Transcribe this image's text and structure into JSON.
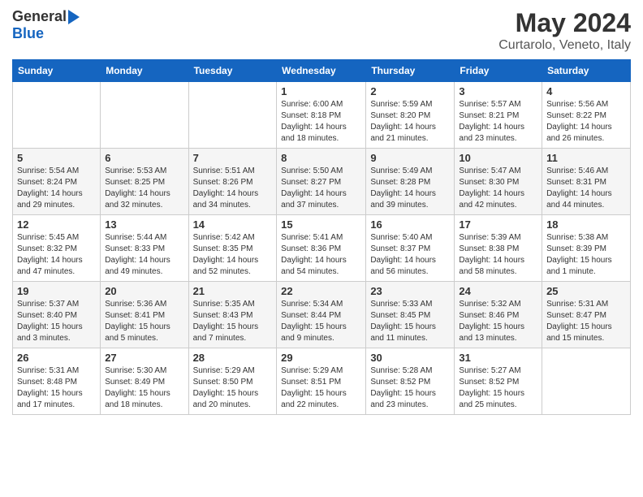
{
  "header": {
    "logo_general": "General",
    "logo_blue": "Blue",
    "month": "May 2024",
    "location": "Curtarolo, Veneto, Italy"
  },
  "columns": [
    "Sunday",
    "Monday",
    "Tuesday",
    "Wednesday",
    "Thursday",
    "Friday",
    "Saturday"
  ],
  "weeks": [
    [
      {
        "day": "",
        "info": ""
      },
      {
        "day": "",
        "info": ""
      },
      {
        "day": "",
        "info": ""
      },
      {
        "day": "1",
        "info": "Sunrise: 6:00 AM\nSunset: 8:18 PM\nDaylight: 14 hours\nand 18 minutes."
      },
      {
        "day": "2",
        "info": "Sunrise: 5:59 AM\nSunset: 8:20 PM\nDaylight: 14 hours\nand 21 minutes."
      },
      {
        "day": "3",
        "info": "Sunrise: 5:57 AM\nSunset: 8:21 PM\nDaylight: 14 hours\nand 23 minutes."
      },
      {
        "day": "4",
        "info": "Sunrise: 5:56 AM\nSunset: 8:22 PM\nDaylight: 14 hours\nand 26 minutes."
      }
    ],
    [
      {
        "day": "5",
        "info": "Sunrise: 5:54 AM\nSunset: 8:24 PM\nDaylight: 14 hours\nand 29 minutes."
      },
      {
        "day": "6",
        "info": "Sunrise: 5:53 AM\nSunset: 8:25 PM\nDaylight: 14 hours\nand 32 minutes."
      },
      {
        "day": "7",
        "info": "Sunrise: 5:51 AM\nSunset: 8:26 PM\nDaylight: 14 hours\nand 34 minutes."
      },
      {
        "day": "8",
        "info": "Sunrise: 5:50 AM\nSunset: 8:27 PM\nDaylight: 14 hours\nand 37 minutes."
      },
      {
        "day": "9",
        "info": "Sunrise: 5:49 AM\nSunset: 8:28 PM\nDaylight: 14 hours\nand 39 minutes."
      },
      {
        "day": "10",
        "info": "Sunrise: 5:47 AM\nSunset: 8:30 PM\nDaylight: 14 hours\nand 42 minutes."
      },
      {
        "day": "11",
        "info": "Sunrise: 5:46 AM\nSunset: 8:31 PM\nDaylight: 14 hours\nand 44 minutes."
      }
    ],
    [
      {
        "day": "12",
        "info": "Sunrise: 5:45 AM\nSunset: 8:32 PM\nDaylight: 14 hours\nand 47 minutes."
      },
      {
        "day": "13",
        "info": "Sunrise: 5:44 AM\nSunset: 8:33 PM\nDaylight: 14 hours\nand 49 minutes."
      },
      {
        "day": "14",
        "info": "Sunrise: 5:42 AM\nSunset: 8:35 PM\nDaylight: 14 hours\nand 52 minutes."
      },
      {
        "day": "15",
        "info": "Sunrise: 5:41 AM\nSunset: 8:36 PM\nDaylight: 14 hours\nand 54 minutes."
      },
      {
        "day": "16",
        "info": "Sunrise: 5:40 AM\nSunset: 8:37 PM\nDaylight: 14 hours\nand 56 minutes."
      },
      {
        "day": "17",
        "info": "Sunrise: 5:39 AM\nSunset: 8:38 PM\nDaylight: 14 hours\nand 58 minutes."
      },
      {
        "day": "18",
        "info": "Sunrise: 5:38 AM\nSunset: 8:39 PM\nDaylight: 15 hours\nand 1 minute."
      }
    ],
    [
      {
        "day": "19",
        "info": "Sunrise: 5:37 AM\nSunset: 8:40 PM\nDaylight: 15 hours\nand 3 minutes."
      },
      {
        "day": "20",
        "info": "Sunrise: 5:36 AM\nSunset: 8:41 PM\nDaylight: 15 hours\nand 5 minutes."
      },
      {
        "day": "21",
        "info": "Sunrise: 5:35 AM\nSunset: 8:43 PM\nDaylight: 15 hours\nand 7 minutes."
      },
      {
        "day": "22",
        "info": "Sunrise: 5:34 AM\nSunset: 8:44 PM\nDaylight: 15 hours\nand 9 minutes."
      },
      {
        "day": "23",
        "info": "Sunrise: 5:33 AM\nSunset: 8:45 PM\nDaylight: 15 hours\nand 11 minutes."
      },
      {
        "day": "24",
        "info": "Sunrise: 5:32 AM\nSunset: 8:46 PM\nDaylight: 15 hours\nand 13 minutes."
      },
      {
        "day": "25",
        "info": "Sunrise: 5:31 AM\nSunset: 8:47 PM\nDaylight: 15 hours\nand 15 minutes."
      }
    ],
    [
      {
        "day": "26",
        "info": "Sunrise: 5:31 AM\nSunset: 8:48 PM\nDaylight: 15 hours\nand 17 minutes."
      },
      {
        "day": "27",
        "info": "Sunrise: 5:30 AM\nSunset: 8:49 PM\nDaylight: 15 hours\nand 18 minutes."
      },
      {
        "day": "28",
        "info": "Sunrise: 5:29 AM\nSunset: 8:50 PM\nDaylight: 15 hours\nand 20 minutes."
      },
      {
        "day": "29",
        "info": "Sunrise: 5:29 AM\nSunset: 8:51 PM\nDaylight: 15 hours\nand 22 minutes."
      },
      {
        "day": "30",
        "info": "Sunrise: 5:28 AM\nSunset: 8:52 PM\nDaylight: 15 hours\nand 23 minutes."
      },
      {
        "day": "31",
        "info": "Sunrise: 5:27 AM\nSunset: 8:52 PM\nDaylight: 15 hours\nand 25 minutes."
      },
      {
        "day": "",
        "info": ""
      }
    ]
  ]
}
